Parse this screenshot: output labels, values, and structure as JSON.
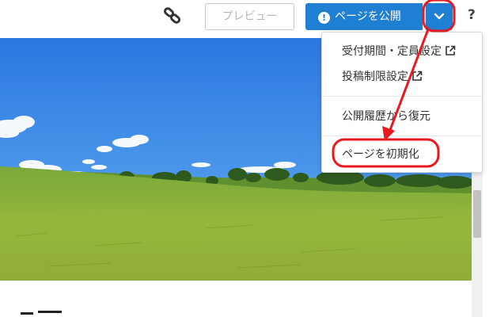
{
  "toolbar": {
    "preview_label": "プレビュー",
    "publish_label": "ページを公開",
    "help_label": "?"
  },
  "menu": {
    "items": [
      {
        "label": "受付期間・定員設定",
        "icon": "external-link-icon"
      },
      {
        "label": "投稿制限設定",
        "icon": "external-link-icon"
      },
      {
        "label": "公開履歴から復元"
      },
      {
        "label": "ページを初期化"
      }
    ]
  },
  "colors": {
    "primary": "#1e7fd3",
    "annotation": "#e8191f"
  }
}
